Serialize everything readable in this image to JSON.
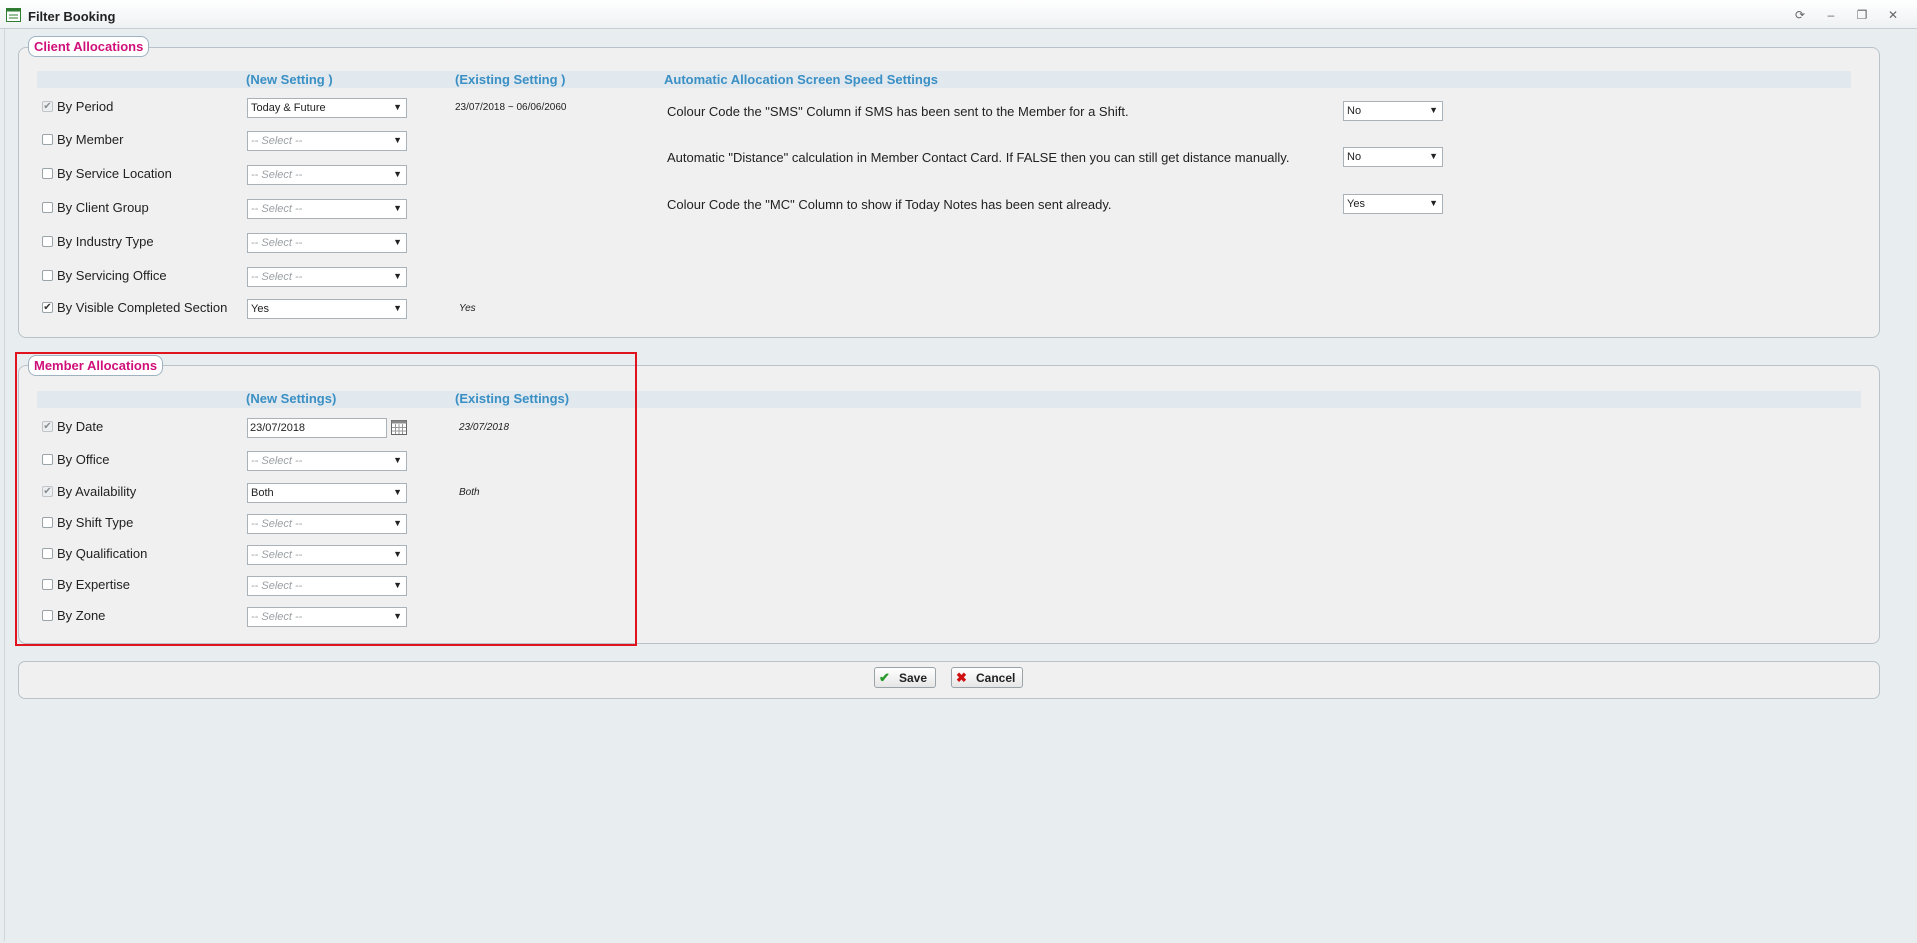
{
  "window": {
    "title": "Filter Booking",
    "controls": {
      "refresh": "⟳",
      "minimize": "‒",
      "maximize": "❐",
      "close": "✕"
    }
  },
  "client_allocations": {
    "legend": "Client Allocations",
    "headers": {
      "new": "(New Setting )",
      "existing": "(Existing Setting )",
      "speed": "Automatic Allocation Screen Speed Settings"
    },
    "rows": [
      {
        "label": "By Period",
        "checked": true,
        "disabled": true,
        "value": "Today & Future",
        "placeholder": false,
        "existing": "23/07/2018 ~ 06/06/2060"
      },
      {
        "label": "By Member",
        "checked": false,
        "disabled": false,
        "value": "-- Select --",
        "placeholder": true,
        "existing": ""
      },
      {
        "label": "By Service Location",
        "checked": false,
        "disabled": false,
        "value": "-- Select --",
        "placeholder": true,
        "existing": ""
      },
      {
        "label": "By Client Group",
        "checked": false,
        "disabled": false,
        "value": "-- Select --",
        "placeholder": true,
        "existing": ""
      },
      {
        "label": "By Industry Type",
        "checked": false,
        "disabled": false,
        "value": "-- Select --",
        "placeholder": true,
        "existing": ""
      },
      {
        "label": "By Servicing Office",
        "checked": false,
        "disabled": false,
        "value": "-- Select --",
        "placeholder": true,
        "existing": ""
      },
      {
        "label": "By Visible Completed Section",
        "checked": true,
        "disabled": false,
        "value": "Yes",
        "placeholder": false,
        "existing": "Yes"
      }
    ],
    "speed_settings": [
      {
        "label": "Colour Code the \"SMS\" Column if SMS has been sent to the Member for a Shift.",
        "value": "No"
      },
      {
        "label": "Automatic \"Distance\" calculation in Member Contact Card. If FALSE then you can still get distance manually.",
        "value": "No"
      },
      {
        "label": "Colour Code the \"MC\" Column to show if Today Notes has been sent already.",
        "value": "Yes"
      }
    ]
  },
  "member_allocations": {
    "legend": "Member Allocations",
    "headers": {
      "new": "(New Settings)",
      "existing": "(Existing Settings)"
    },
    "rows": [
      {
        "label": "By Date",
        "checked": true,
        "disabled": true,
        "type": "date",
        "value": "23/07/2018",
        "existing": "23/07/2018"
      },
      {
        "label": "By Office",
        "checked": false,
        "disabled": false,
        "type": "select",
        "value": "-- Select --",
        "placeholder": true,
        "existing": ""
      },
      {
        "label": "By Availability",
        "checked": true,
        "disabled": true,
        "type": "select",
        "value": "Both",
        "placeholder": false,
        "existing": "Both"
      },
      {
        "label": "By Shift Type",
        "checked": false,
        "disabled": false,
        "type": "select",
        "value": "-- Select --",
        "placeholder": true,
        "existing": ""
      },
      {
        "label": "By Qualification",
        "checked": false,
        "disabled": false,
        "type": "select",
        "value": "-- Select --",
        "placeholder": true,
        "existing": ""
      },
      {
        "label": "By Expertise",
        "checked": false,
        "disabled": false,
        "type": "select",
        "value": "-- Select --",
        "placeholder": true,
        "existing": ""
      },
      {
        "label": "By Zone",
        "checked": false,
        "disabled": false,
        "type": "select",
        "value": "-- Select --",
        "placeholder": true,
        "existing": ""
      }
    ]
  },
  "buttons": {
    "save": "Save",
    "cancel": "Cancel"
  },
  "colors": {
    "legend": "#d0107a",
    "header": "#3a8fc4",
    "highlight": "#e0141e",
    "save_icon": "#2a9a2a",
    "cancel_icon": "#d01010"
  },
  "icons": {
    "app": "window-icon",
    "calendar": "calendar-icon",
    "save": "checkmark-icon",
    "cancel": "x-icon",
    "dropdown": "chevron-down-icon"
  }
}
